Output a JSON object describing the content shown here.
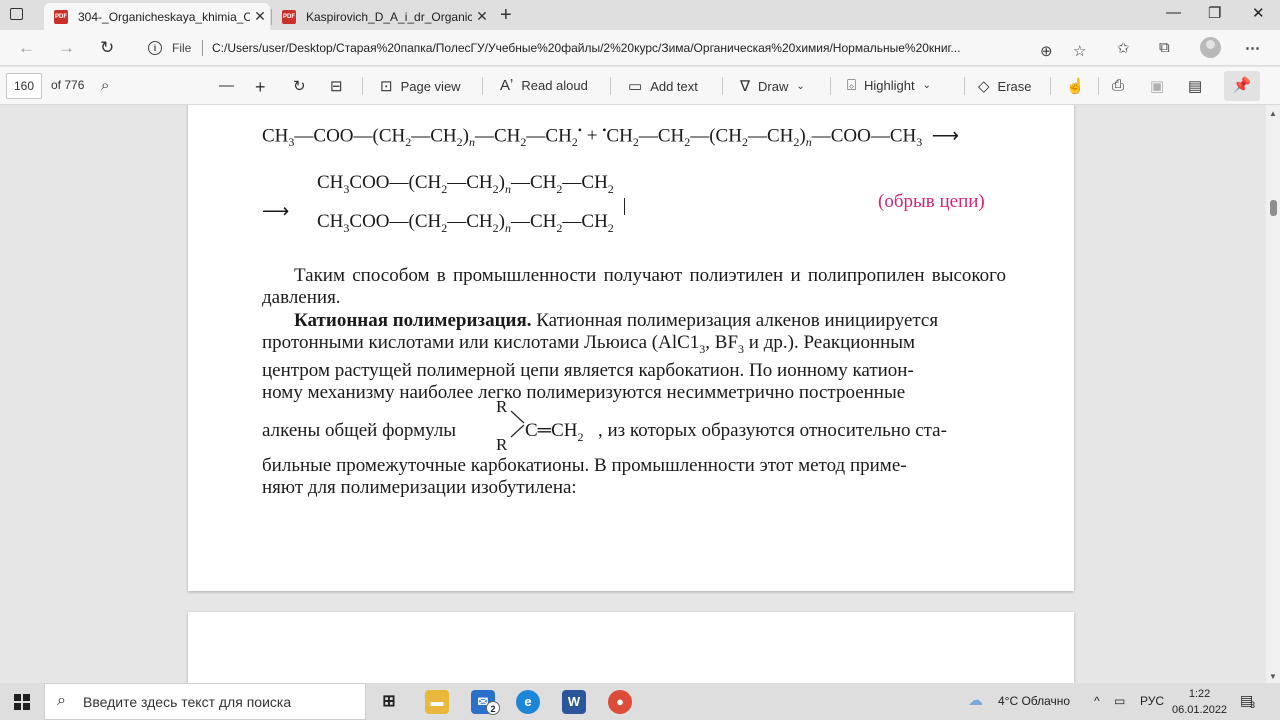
{
  "tabs": [
    {
      "title": "304-_Organicheskaya_khimia_Ch",
      "active": true
    },
    {
      "title": "Kaspirovich_D_A_i_dr_Organiche",
      "active": false
    }
  ],
  "address": {
    "scheme_label": "File",
    "url": "C:/Users/user/Desktop/Старая%20папка/ПолесГУ/Учебные%20файлы/2%20курс/Зима/Органическая%20химия/Нормальные%20книг..."
  },
  "pdf_toolbar": {
    "page_number": "160",
    "page_count_label": "of 776",
    "page_view": "Page view",
    "read_aloud": "Read aloud",
    "add_text": "Add text",
    "draw": "Draw",
    "highlight": "Highlight",
    "erase": "Erase"
  },
  "document": {
    "chain_break": "(обрыв цепи)",
    "para1": "Таким способом в промышленности получают полиэтилен и полипропилен высокого давления.",
    "para2_bold": "Катионная полимеризация.",
    "para2_line1": " Катионная полимеризация алкенов инициируется",
    "para2_line2": "протонными кислотами или кислотами Льюиса (AlC1",
    "para2_line2b": ", BF",
    "para2_line2c": " и др.). Реакционным",
    "para2_line3": "центром растущей полимерной цепи является карбокатион. По ионному катион-",
    "para2_line4": "ному механизму наиболее легко полимеризуются несимметрично построенные",
    "para2_line5a": "алкены общей формулы",
    "para2_line5b": ", из которых образуются относительно ста-",
    "para2_line6": "бильные промежуточные карбокатионы. В промышленности этот метод приме-",
    "para2_line7": "няют для полимеризации изобутилена:"
  },
  "taskbar": {
    "search_placeholder": "Введите здесь текст для поиска",
    "mail_badge": "2",
    "weather": "4°C  Облачно",
    "lang": "РУС",
    "time": "1:22",
    "date": "06.01.2022",
    "notif_count": "3"
  }
}
